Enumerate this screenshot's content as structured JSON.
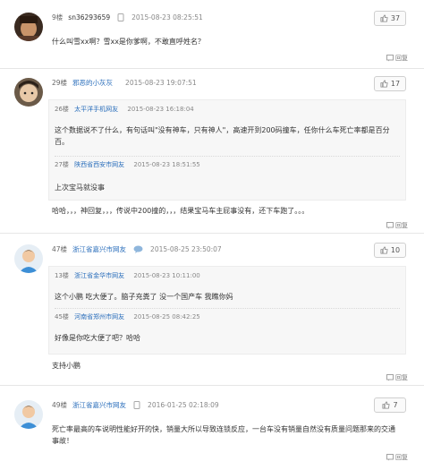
{
  "comments": [
    {
      "floor": "9楼",
      "user": "sn36293659",
      "time": "2015-08-23 08:25:51",
      "likes": "37",
      "text": "什么叫雪xx啊？雪xx是你爹啊，不敢直呼姓名？",
      "reply": "回复"
    },
    {
      "floor": "29楼",
      "user": "邪恶的小灰灰",
      "time": "2015-08-23 19:07:51",
      "likes": "17",
      "quotes": [
        {
          "floor": "26楼",
          "user": "太平洋手机网友",
          "time": "2015-08-23 16:18:04",
          "text": "这个数据说不了什么，有句话叫\"没有神车，只有神人\"，高速开到200码撞车，任你什么车死亡率都是百分百。"
        },
        {
          "floor": "27楼",
          "user": "陕西省西安市网友",
          "time": "2015-08-23 18:51:55",
          "text": "上次宝马就没事"
        }
      ],
      "text": "哈哈，，，神回复，，，传说中200撞的，，，结果宝马车主屁事没有，还下车跑了。。。",
      "reply": "回复"
    },
    {
      "floor": "47楼",
      "user": "浙江省嘉兴市网友",
      "time": "2015-08-25 23:50:07",
      "likes": "10",
      "quotes": [
        {
          "floor": "13楼",
          "user": "浙江省金华市网友",
          "time": "2015-08-23 10:11:00",
          "text": "这个小鹏 吃大便了。脑子充粪了 没一个国产车 我瞧你妈"
        },
        {
          "floor": "45楼",
          "user": "河南省郑州市网友",
          "time": "2015-08-25 08:42:25",
          "text": "好像是你吃大便了吧？哈哈"
        }
      ],
      "text": "支持小鹏",
      "reply": "回复"
    },
    {
      "floor": "49楼",
      "user": "浙江省嘉兴市网友",
      "time": "2016-01-25 02:18:09",
      "likes": "7",
      "text": "死亡率最高的车说明性能好开的快，销量大所以导致连锁反应，一台车没有销量自然没有质量问题那来的交通事故！",
      "reply": "回复"
    }
  ],
  "colors": {
    "link": "#2a6ebb",
    "border": "#e6e6e6",
    "quote_bg": "#f7f7f7"
  },
  "icons": {
    "like": "thumbs-up-icon",
    "reply": "reply-icon",
    "phone": "phone-icon",
    "chat": "chat-icon"
  }
}
